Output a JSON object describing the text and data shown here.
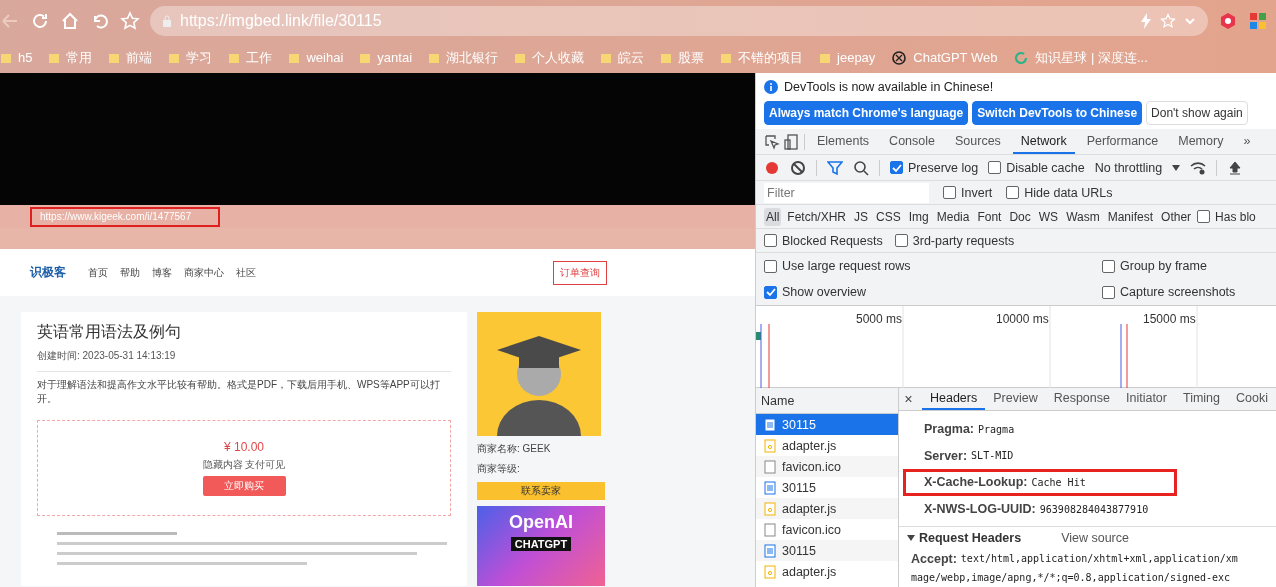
{
  "browser": {
    "url_host": "https://imgbed.link",
    "url_path": "/file/30115",
    "bookmarks": [
      {
        "label": "h5",
        "kind": "folder"
      },
      {
        "label": "常用",
        "kind": "folder"
      },
      {
        "label": "前端",
        "kind": "folder"
      },
      {
        "label": "学习",
        "kind": "folder"
      },
      {
        "label": "工作",
        "kind": "folder"
      },
      {
        "label": "weihai",
        "kind": "folder"
      },
      {
        "label": "yantai",
        "kind": "folder"
      },
      {
        "label": "湖北银行",
        "kind": "folder"
      },
      {
        "label": "个人收藏",
        "kind": "folder"
      },
      {
        "label": "皖云",
        "kind": "folder"
      },
      {
        "label": "股票",
        "kind": "folder"
      },
      {
        "label": "不错的项目",
        "kind": "folder"
      },
      {
        "label": "jeepay",
        "kind": "folder"
      },
      {
        "label": "ChatGPT Web",
        "kind": "knot"
      },
      {
        "label": "知识星球 | 深度连...",
        "kind": "ring"
      }
    ]
  },
  "inner_page": {
    "url": "https://www.kigeek.com/i/1477567",
    "logo": "识极客",
    "nav": [
      "首页",
      "帮助",
      "博客",
      "商家中心",
      "社区"
    ],
    "order_button": "订单查询",
    "title": "英语常用语法及例句",
    "created": "创建时间: 2023-05-31 14:13:19",
    "description": "对于理解语法和提高作文水平比较有帮助。格式是PDF，下载后用手机、WPS等APP可以打开。",
    "price": "¥ 10.00",
    "hidden_note": "隐藏内容 支付可见",
    "buy_button": "立即购买",
    "seller_name": "商家名称: GEEK",
    "seller_level": "商家等级:",
    "contact_button": "联系卖家",
    "ad_title": "OpenAI",
    "ad_sub": "CHATGPT"
  },
  "devtools": {
    "notice": "DevTools is now available in Chinese!",
    "notice_buttons": [
      {
        "label": "Always match Chrome's language",
        "kind": "primary"
      },
      {
        "label": "Switch DevTools to Chinese",
        "kind": "primary"
      },
      {
        "label": "Don't show again",
        "kind": "plain"
      }
    ],
    "tabs": [
      {
        "label": "Elements",
        "selected": false
      },
      {
        "label": "Console",
        "selected": false
      },
      {
        "label": "Sources",
        "selected": false
      },
      {
        "label": "Network",
        "selected": true
      },
      {
        "label": "Performance",
        "selected": false
      },
      {
        "label": "Memory",
        "selected": false
      }
    ],
    "more_tabs": "»",
    "toolbar_checks": [
      {
        "label": "Preserve log",
        "checked": true
      },
      {
        "label": "Disable cache",
        "checked": false
      }
    ],
    "throttling": "No throttling",
    "filter_placeholder": "Filter",
    "filter_checks": [
      {
        "label": "Invert",
        "checked": false
      },
      {
        "label": "Hide data URLs",
        "checked": false
      }
    ],
    "types": [
      {
        "label": "All",
        "selected": true
      },
      {
        "label": "Fetch/XHR",
        "selected": false
      },
      {
        "label": "JS",
        "selected": false
      },
      {
        "label": "CSS",
        "selected": false
      },
      {
        "label": "Img",
        "selected": false
      },
      {
        "label": "Media",
        "selected": false
      },
      {
        "label": "Font",
        "selected": false
      },
      {
        "label": "Doc",
        "selected": false
      },
      {
        "label": "WS",
        "selected": false
      },
      {
        "label": "Wasm",
        "selected": false
      },
      {
        "label": "Manifest",
        "selected": false
      },
      {
        "label": "Other",
        "selected": false
      }
    ],
    "has_blocked": {
      "label": "Has blo",
      "checked": false
    },
    "request_checks": [
      {
        "label": "Blocked Requests",
        "checked": false
      },
      {
        "label": "3rd-party requests",
        "checked": false
      }
    ],
    "options": [
      {
        "label": "Use large request rows",
        "checked": false
      },
      {
        "label": "Group by frame",
        "checked": false
      },
      {
        "label": "Show overview",
        "checked": true
      },
      {
        "label": "Capture screenshots",
        "checked": false
      }
    ],
    "timeline_ticks": [
      "5000 ms",
      "10000 ms",
      "15000 ms"
    ],
    "name_header": "Name",
    "requests": [
      {
        "name": "30115",
        "kind": "doc",
        "selected": true
      },
      {
        "name": "adapter.js",
        "kind": "script",
        "selected": false
      },
      {
        "name": "favicon.ico",
        "kind": "other",
        "selected": false
      },
      {
        "name": "30115",
        "kind": "doc",
        "selected": false
      },
      {
        "name": "adapter.js",
        "kind": "script",
        "selected": false
      },
      {
        "name": "favicon.ico",
        "kind": "other",
        "selected": false
      },
      {
        "name": "30115",
        "kind": "doc",
        "selected": false
      },
      {
        "name": "adapter.js",
        "kind": "script",
        "selected": false
      }
    ],
    "detail_tabs": [
      {
        "label": "Headers",
        "selected": true
      },
      {
        "label": "Preview",
        "selected": false
      },
      {
        "label": "Response",
        "selected": false
      },
      {
        "label": "Initiator",
        "selected": false
      },
      {
        "label": "Timing",
        "selected": false
      },
      {
        "label": "Cooki",
        "selected": false
      }
    ],
    "response_headers": [
      {
        "key": "Pragma:",
        "value": "Pragma",
        "highlighted": false
      },
      {
        "key": "Server:",
        "value": "SLT-MID",
        "highlighted": false
      },
      {
        "key": "X-Cache-Lookup:",
        "value": "Cache Hit",
        "highlighted": true
      },
      {
        "key": "X-NWS-LOG-UUID:",
        "value": "963908284043877910",
        "highlighted": false
      }
    ],
    "request_headers_title": "Request Headers",
    "view_source": "View source",
    "accept": {
      "key": "Accept:",
      "value": "text/html,application/xhtml+xml,application/xm",
      "continued": "mage/webp,image/apng,*/*;q=0.8,application/signed-exc"
    }
  }
}
